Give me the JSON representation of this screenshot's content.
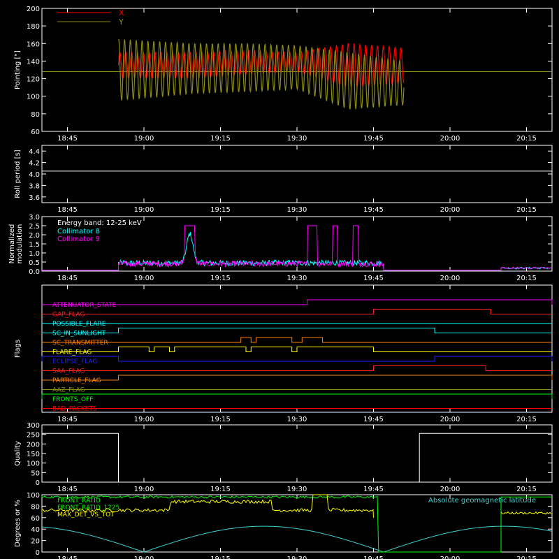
{
  "time_ticks": [
    "18:45",
    "19:00",
    "19:15",
    "19:30",
    "19:45",
    "20:00",
    "20:15"
  ],
  "chart_data": [
    {
      "type": "line",
      "ylabel": "Pointing [\"]",
      "ylim": [
        60,
        200
      ],
      "yticks": [
        60,
        80,
        100,
        120,
        140,
        160,
        180,
        200
      ],
      "legend": "top-left",
      "series": [
        {
          "name": "X",
          "color": "#ff0000",
          "segments": [
            [
              "19:10",
              120,
              150
            ],
            [
              "19:20",
              125,
              152
            ],
            [
              "19:30",
              128,
              150
            ],
            [
              "19:40",
              110,
              160
            ],
            [
              "19:51",
              115,
              155
            ]
          ]
        },
        {
          "name": "Y",
          "color": "#8c8c14",
          "segments": [
            [
              "18:55",
              95,
              165
            ],
            [
              "19:10",
              103,
              160
            ],
            [
              "19:20",
              105,
              160
            ],
            [
              "19:30",
              108,
              158
            ],
            [
              "19:40",
              85,
              150
            ],
            [
              "19:51",
              90,
              140
            ]
          ]
        }
      ],
      "reference_level": 128
    },
    {
      "type": "line",
      "ylabel": "Roll period [s]",
      "ylim": [
        3.5,
        4.5
      ],
      "yticks": [
        3.6,
        3.8,
        4.0,
        4.2,
        4.4
      ],
      "series": [
        {
          "name": "",
          "color": "#ffffff",
          "value": 4.05
        }
      ]
    },
    {
      "type": "line",
      "ylabel_lines": [
        "Normalized",
        "modulation"
      ],
      "ylim": [
        0,
        3.0
      ],
      "yticks": [
        0.0,
        0.5,
        1.0,
        1.5,
        2.0,
        2.5,
        3.0
      ],
      "annotation": "Energy band: 12-25 keV",
      "legend": "top-left",
      "series": [
        {
          "name": "Collimator 8",
          "color": "#00ffff"
        },
        {
          "name": "Collimator 9",
          "color": "#ff00ff"
        }
      ],
      "events": [
        [
          "19:08",
          "19:10",
          2.5
        ],
        [
          "19:32",
          "19:34",
          2.5
        ],
        [
          "19:37",
          "19:38",
          2.5
        ],
        [
          "19:41",
          "19:42",
          2.5
        ]
      ]
    },
    {
      "type": "timeline",
      "ylabel": "Flags",
      "flags": [
        {
          "name": "ATTENUATOR_STATE",
          "color": "#ff00ff",
          "on": [
            [
              "19:32",
              "20:20"
            ]
          ]
        },
        {
          "name": "GAP_FLAG",
          "color": "#ff2020",
          "on": [
            [
              "19:45",
              "20:08"
            ]
          ]
        },
        {
          "name": "POSSIBLE_FLARE",
          "color": "#00ffff",
          "on": []
        },
        {
          "name": "SC_IN_SUNLIGHT",
          "color": "#00ffff",
          "on": [
            [
              "18:55",
              "19:57"
            ]
          ]
        },
        {
          "name": "SC_TRANSMITTER",
          "color": "#ff8000",
          "on": [
            [
              "19:19",
              "19:21"
            ],
            [
              "19:22",
              "19:29"
            ],
            [
              "19:31",
              "19:35"
            ]
          ]
        },
        {
          "name": "FLARE_FLAG",
          "color": "#ffff00",
          "on": [
            [
              "18:55",
              "19:01"
            ],
            [
              "19:02",
              "19:05"
            ],
            [
              "19:06",
              "19:20"
            ],
            [
              "19:21",
              "19:29"
            ],
            [
              "19:30",
              "19:45"
            ]
          ]
        },
        {
          "name": "ECLIPSE_FLAG",
          "color": "#2020ff",
          "on": [
            [
              "18:40",
              "18:55"
            ],
            [
              "19:57",
              "20:20"
            ]
          ]
        },
        {
          "name": "SAA_FLAG",
          "color": "#ff2020",
          "on": [
            [
              "19:45",
              "20:07"
            ]
          ]
        },
        {
          "name": "PARTICLE_FLAG",
          "color": "#ff8000",
          "on": [
            [
              "18:55",
              "20:20"
            ]
          ]
        },
        {
          "name": "AAZ_FLAG",
          "color": "#8c8c14",
          "on": []
        },
        {
          "name": "FRONTS_OFF",
          "color": "#00ff00",
          "on": [
            [
              "18:40",
              "20:20"
            ]
          ]
        },
        {
          "name": "BAD_PACKETS",
          "color": "#ff0000",
          "on": []
        }
      ]
    },
    {
      "type": "line",
      "ylabel": "Quality",
      "ylim": [
        0,
        300
      ],
      "yticks": [
        0,
        50,
        100,
        150,
        200,
        250,
        300
      ],
      "series": [
        {
          "name": "",
          "color": "#ffffff",
          "points": [
            [
              "18:40",
              255
            ],
            [
              "18:55",
              255
            ],
            [
              "18:55",
              0
            ],
            [
              "19:54",
              0
            ],
            [
              "19:54",
              255
            ],
            [
              "20:20",
              255
            ]
          ]
        }
      ]
    },
    {
      "type": "line",
      "ylabel": "Degrees or %",
      "ylim": [
        0,
        100
      ],
      "yticks": [
        0,
        20,
        40,
        60,
        80,
        100
      ],
      "legend": "top-left",
      "series": [
        {
          "name": "FRONT_RATIO",
          "color": "#00ff00"
        },
        {
          "name": "FRONT_RATIO_1225",
          "color": "#00ff00"
        },
        {
          "name": "MAX_DET_VS_TOT",
          "color": "#ffff00"
        },
        {
          "name": "Absolute geomagnetic latitude",
          "color": "#40d0d0"
        }
      ]
    }
  ]
}
